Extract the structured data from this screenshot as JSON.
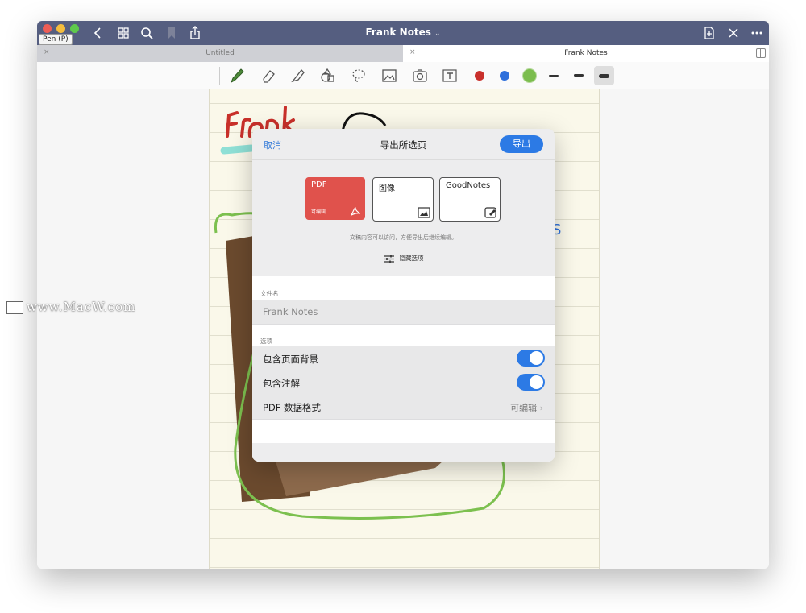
{
  "window": {
    "title": "Frank Notes",
    "tooltip": "Pen (P)"
  },
  "tabs": [
    {
      "label": "Untitled",
      "active": false
    },
    {
      "label": "Frank Notes",
      "active": true
    }
  ],
  "toolbar": {
    "tools": [
      "pen-icon",
      "eraser-icon",
      "highlighter-icon",
      "shapes-icon",
      "lasso-icon",
      "image-icon",
      "camera-icon",
      "textbox-icon"
    ],
    "colors": [
      "#c9302c",
      "#2d6fdb",
      "#7bbd4e"
    ]
  },
  "watermark": "www.MacW.com",
  "dialog": {
    "cancel": "取消",
    "title": "导出所选页",
    "export": "导出",
    "formats": [
      {
        "label": "PDF",
        "sub": "可编辑",
        "selected": true
      },
      {
        "label": "图像",
        "selected": false
      },
      {
        "label": "GoodNotes",
        "selected": false
      }
    ],
    "description": "文稿内容可以访问，方便导出后继续编辑。",
    "hide_options": "隐藏选项",
    "filename_label": "文件名",
    "filename_placeholder": "Frank Notes",
    "options_label": "选项",
    "options": [
      {
        "label": "包含页面背景",
        "enabled": true
      },
      {
        "label": "包含注解",
        "enabled": true
      }
    ],
    "pdf_format": {
      "label": "PDF 数据格式",
      "value": "可编辑"
    }
  }
}
